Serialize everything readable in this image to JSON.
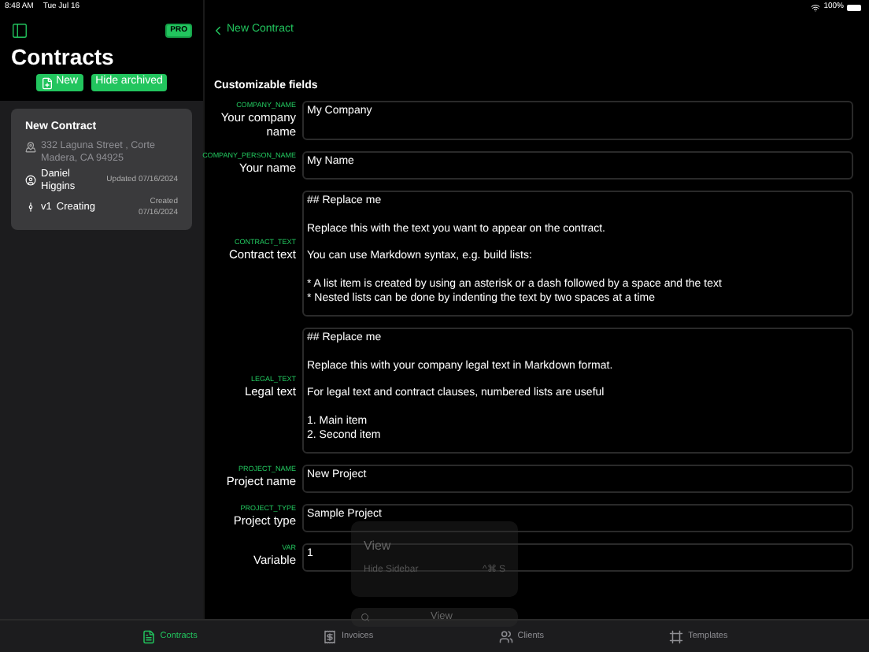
{
  "status_bar": {
    "time": "8:48 AM",
    "date": "Tue Jul 16",
    "battery": "100%"
  },
  "sidebar": {
    "badge": "PRO",
    "title": "Contracts",
    "buttons": [
      {
        "label": "New",
        "kind": "new"
      },
      {
        "label": "Hide archived",
        "kind": "plain"
      }
    ],
    "contracts": [
      {
        "title": "New Contract",
        "address": "332 Laguna Street , Corte Madera, CA 94925",
        "client": "Daniel Higgins",
        "updated": "Updated 07/16/2024",
        "version": "v1",
        "status": "Creating",
        "created": "Created 07/16/2024",
        "selected": true
      }
    ]
  },
  "detail": {
    "back": "New Contract",
    "section": "Customizable fields",
    "fields": [
      {
        "key": "COMPANY_NAME",
        "label": "Your company name",
        "kind": "tall",
        "lines": [
          "My Company"
        ]
      },
      {
        "key": "COMPANY_PERSON_NAME",
        "label": "Your name",
        "kind": "line",
        "lines": [
          "My Name"
        ]
      },
      {
        "key": "CONTRACT_TEXT",
        "label": "Contract text",
        "kind": "text",
        "lines": [
          [
            "## Replace me"
          ],
          [
            "Replace this with the text you want to appear on the contract."
          ],
          [
            "You can use Markdown syntax, e.g. build lists:"
          ],
          [
            "* A list item is created by using an asterisk or a dash followed by a space and the text",
            "* Nested lists can be done by indenting the text by two spaces at a time"
          ]
        ]
      },
      {
        "key": "LEGAL_TEXT",
        "label": "Legal text",
        "kind": "text",
        "lines": [
          [
            "## Replace me"
          ],
          [
            "Replace this with your company legal text in Markdown format."
          ],
          [
            "For legal text and contract clauses, numbered lists are useful"
          ],
          [
            "1. Main item",
            "2. Second item"
          ]
        ]
      },
      {
        "key": "PROJECT_NAME",
        "label": "Project name",
        "kind": "line",
        "lines": [
          "New Project"
        ]
      },
      {
        "key": "PROJECT_TYPE",
        "label": "Project type",
        "kind": "line",
        "lines": [
          "Sample Project"
        ]
      },
      {
        "key": "VAR",
        "label": "Variable",
        "kind": "line",
        "lines": [
          "1"
        ]
      }
    ]
  },
  "menu": {
    "title": "View",
    "items": [
      {
        "label": "Hide Sidebar",
        "shortcut": "^⌘ S"
      }
    ],
    "search": "View"
  },
  "tabs": [
    {
      "label": "Contracts",
      "kind": "contracts",
      "selected": true
    },
    {
      "label": "Invoices",
      "kind": "invoices",
      "selected": false
    },
    {
      "label": "Clients",
      "kind": "clients",
      "selected": false
    },
    {
      "label": "Templates",
      "kind": "templates",
      "selected": false
    }
  ]
}
